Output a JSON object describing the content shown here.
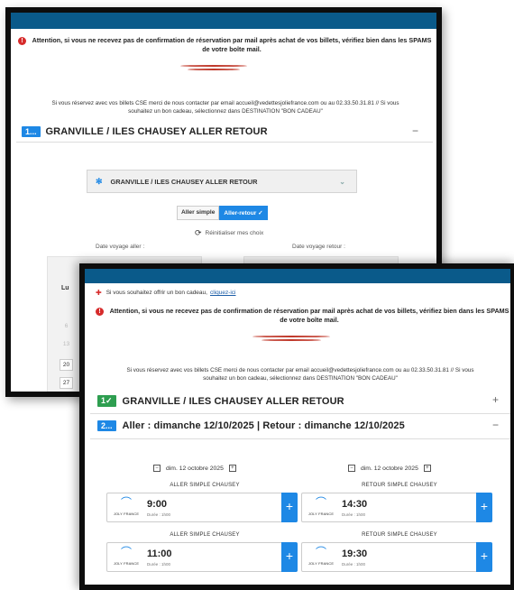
{
  "back": {
    "warning_line1": "Attention, si vous ne recevez pas de confirmation de réservation par mail après achat de vos billets, vérifiez bien dans les SPAMS",
    "warning_line2": "de votre boîte mail.",
    "info_line1": "Si vous réservez avec vos billets CSE merci de nous contacter par email accueil@vedettesjoliefrance.com ou au 02.33.50.31.81 // Si vous",
    "info_line2": "souhaitez un bon cadeau, sélectionnez dans DESTINATION \"BON CADEAU\"",
    "step1_badge": "1...",
    "step1_title": "GRANVILLE / ILES CHAUSEY ALLER RETOUR",
    "step1_toggle": "−",
    "destination_label": "GRANVILLE / ILES CHAUSEY ALLER RETOUR",
    "trip_simple": "Aller simple",
    "trip_return": "Aller-retour ✓",
    "reset_label": "Réinitialiser mes choix",
    "date_aller_label": "Date voyage aller :",
    "date_retour_label": "Date voyage retour :",
    "weekday_lu": "Lu",
    "days": [
      "6",
      "13",
      "20",
      "27"
    ]
  },
  "front": {
    "gift_text": "Si vous souhaitez offrir un bon cadeau,",
    "gift_link": "cliquez-ici",
    "warning_line1": "Attention, si vous ne recevez pas de confirmation de réservation par mail après achat de vos billets, vérifiez bien dans les SPAMS",
    "warning_line2": "de votre boîte mail.",
    "info_line1": "Si vous réservez avec vos billets CSE merci de nous contacter par email accueil@vedettesjoliefrance.com ou au 02.33.50.31.81 // Si vous",
    "info_line2": "souhaitez un bon cadeau, sélectionnez dans DESTINATION \"BON CADEAU\"",
    "step1_badge": "1✓",
    "step1_title": "GRANVILLE / ILES CHAUSEY ALLER RETOUR",
    "step1_toggle": "+",
    "step2_badge": "2...",
    "step2_title": "Aller : dimanche 12/10/2025 | Retour : dimanche 12/10/2025",
    "step2_toggle": "−",
    "date_left": "dim. 12 octobre 2025",
    "date_right": "dim. 12 octobre 2025",
    "cap_aller": "ALLER SIMPLE CHAUSEY",
    "cap_retour": "RETOUR SIMPLE CHAUSEY",
    "brand": "JOLY FRANCE",
    "duration": "Durée : 1h00",
    "times": {
      "a1": "9:00",
      "r1": "14:30",
      "a2": "11:00",
      "r2": "19:30"
    },
    "nav_prev": "−",
    "nav_next": "+",
    "add": "+"
  },
  "colors": {
    "accent": "#1e88e5",
    "done": "#2e9e50",
    "topbar": "#0a5a8a",
    "warning": "#d62b2b"
  }
}
